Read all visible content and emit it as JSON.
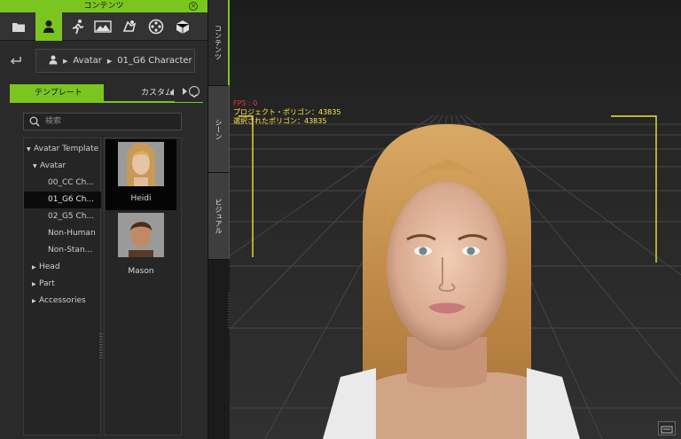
{
  "panel": {
    "title": "コンテンツ",
    "tabs": [
      "folder-icon",
      "avatar-icon",
      "motion-icon",
      "stage-icon",
      "prop-icon",
      "media-icon",
      "package-icon"
    ],
    "breadcrumb": [
      "Avatar",
      "01_G6 Character"
    ],
    "subtabs": {
      "template": "テンプレート",
      "custom": "カスタム"
    },
    "search_placeholder": "検索",
    "tree": [
      {
        "label": "Avatar Template",
        "level": 0,
        "arrow": "down"
      },
      {
        "label": "Avatar",
        "level": 1,
        "arrow": "down"
      },
      {
        "label": "00_CC Ch...",
        "level": 2
      },
      {
        "label": "01_G6 Ch...",
        "level": 2,
        "selected": true
      },
      {
        "label": "02_G5 Ch...",
        "level": 2
      },
      {
        "label": "Non-Human",
        "level": 2
      },
      {
        "label": "Non-Stan...",
        "level": 2
      },
      {
        "label": "Head",
        "level": 0,
        "arrow": "right"
      },
      {
        "label": "Part",
        "level": 0,
        "arrow": "right"
      },
      {
        "label": "Accessories",
        "level": 0,
        "arrow": "right"
      }
    ],
    "thumbnails": [
      {
        "label": "Heidi",
        "selected": true
      },
      {
        "label": "Mason"
      }
    ]
  },
  "side_tabs": [
    "コンテンツ",
    "シーン",
    "ビジュアル"
  ],
  "viewport": {
    "hud_fps": "FPS : 0",
    "hud_project_polygons": "プロジェクト・ポリゴン：43835",
    "hud_selected_polygons": "選択されたポリゴン：43835"
  },
  "colors": {
    "accent": "#7bc520",
    "hud_yellow": "#ffe84a",
    "hud_red": "#e03a3a"
  }
}
